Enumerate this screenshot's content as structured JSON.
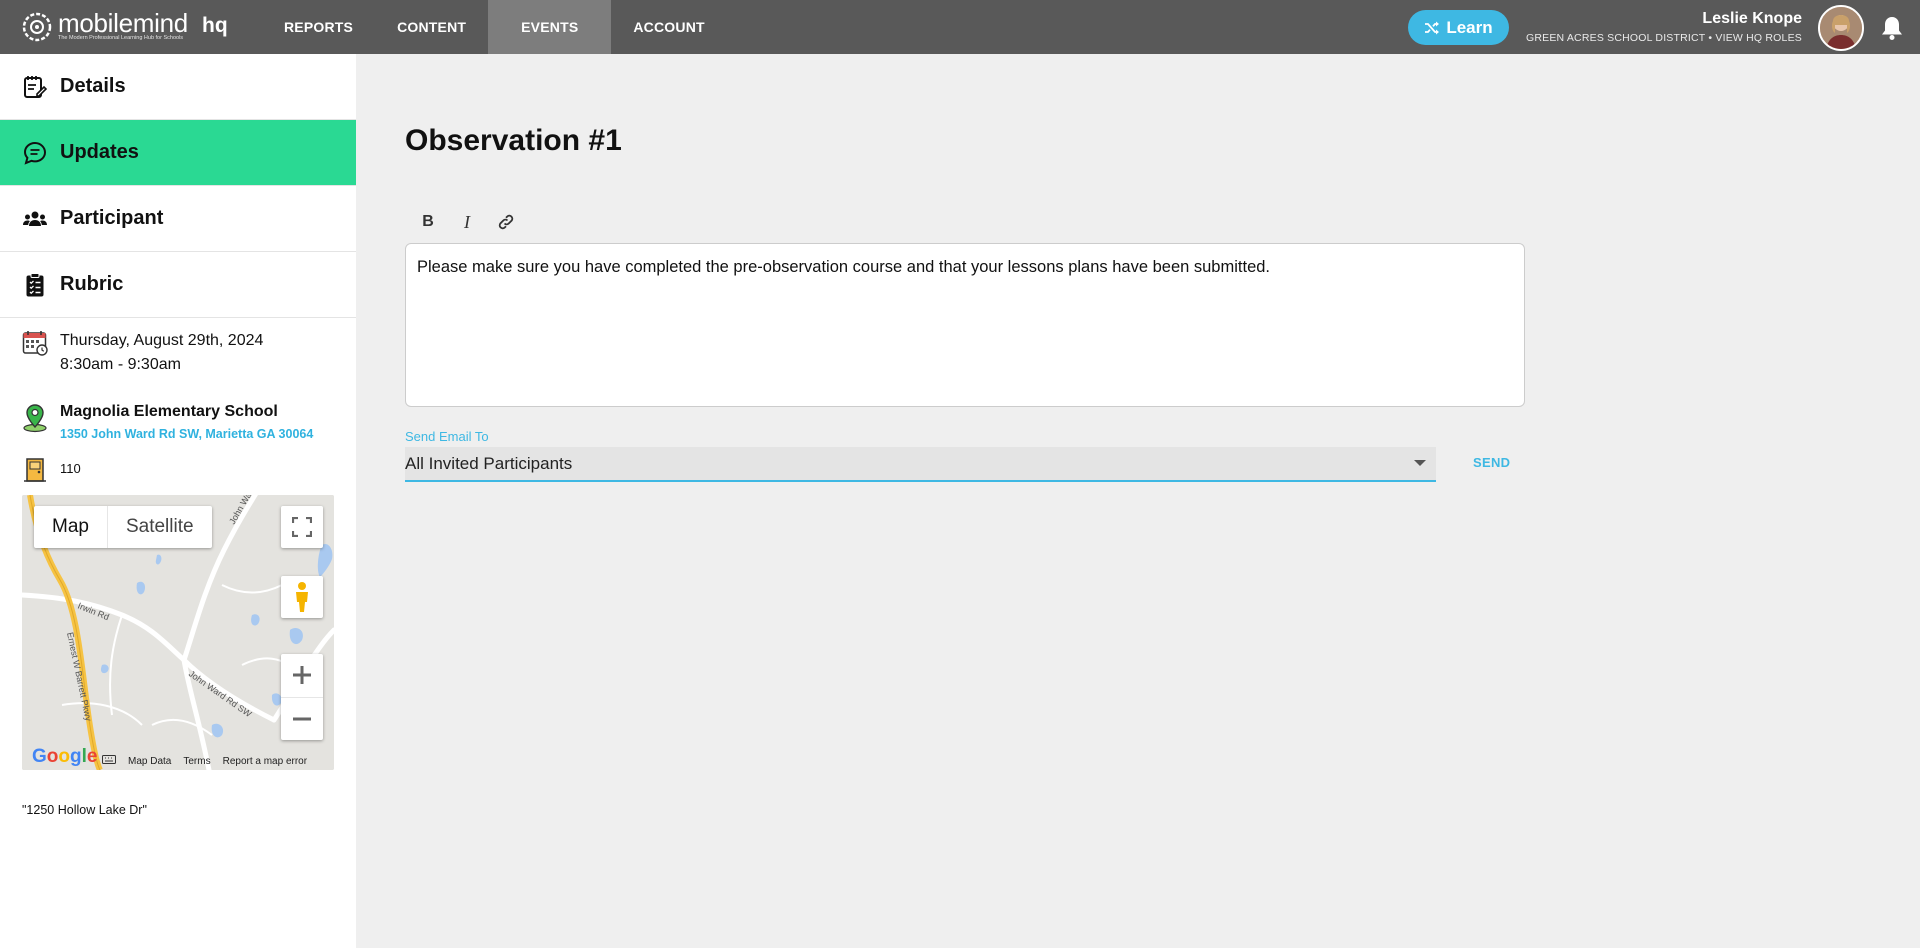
{
  "brand": {
    "name": "mobilemind",
    "tagline": "The Modern Professional Learning Hub for Schools",
    "suffix": "hq"
  },
  "nav": {
    "items": [
      {
        "label": "REPORTS"
      },
      {
        "label": "CONTENT"
      },
      {
        "label": "EVENTS",
        "active": true
      },
      {
        "label": "ACCOUNT"
      }
    ]
  },
  "learn_button": {
    "label": "Learn",
    "icon": "shuffle-icon"
  },
  "user": {
    "name": "Leslie Knope",
    "district": "GREEN ACRES SCHOOL DISTRICT",
    "separator": "•",
    "roles_link": "VIEW HQ ROLES"
  },
  "sidebar": {
    "items": [
      {
        "label": "Details",
        "icon": "notepad-icon"
      },
      {
        "label": "Updates",
        "icon": "chat-bubble-icon",
        "active": true
      },
      {
        "label": "Participant",
        "icon": "people-icon"
      },
      {
        "label": "Rubric",
        "icon": "clipboard-icon"
      }
    ],
    "date": "Thursday, August 29th, 2024",
    "time": "8:30am - 9:30am",
    "location_name": "Magnolia Elementary School",
    "location_address": "1350 John Ward Rd SW, Marietta GA 30064",
    "room": "110",
    "note": "\"1250 Hollow Lake Dr\""
  },
  "map": {
    "type_map": "Map",
    "type_satellite": "Satellite",
    "roads": [
      "John Ward Rd",
      "Irwin Rd",
      "Ernest W Barrett Pkwy",
      "John Ward Rd SW"
    ],
    "footer": {
      "google": "Google",
      "map_data": "Map Data",
      "terms": "Terms",
      "report": "Report a map error"
    }
  },
  "main": {
    "title": "Observation #1",
    "toolbar": {
      "bold": "B",
      "italic": "I"
    },
    "editor_text": "Please make sure you have completed the pre-observation course and that your lessons plans have been submitted.",
    "send_email_label": "Send Email To",
    "send_email_value": "All Invited Participants",
    "send_button": "SEND"
  },
  "colors": {
    "topbar": "#595959",
    "nav_active": "#7d7d7d",
    "accent_blue": "#3eb8e3",
    "sidebar_active": "#2ad993",
    "page_bg": "#efefef"
  }
}
